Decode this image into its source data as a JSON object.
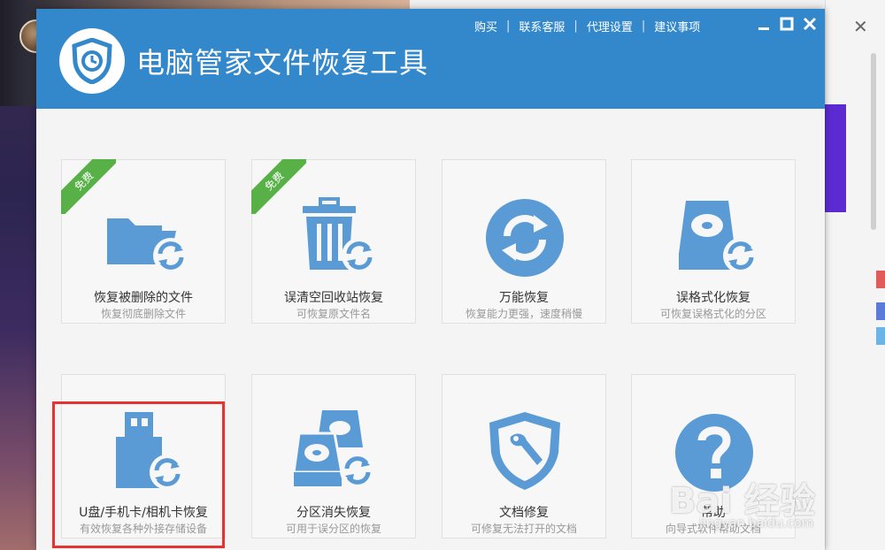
{
  "app": {
    "title": "电脑管家文件恢复工具",
    "menu": [
      "购买",
      "联系客服",
      "代理设置",
      "建议事项"
    ],
    "accent": "#3388cc",
    "icon_color": "#5b9bd5"
  },
  "free_badge": "免费",
  "cards": [
    {
      "name": "恢复被删除的文件",
      "desc": "恢复彻底删除文件",
      "icon": "folder-restore-icon",
      "free": true
    },
    {
      "name": "误清空回收站恢复",
      "desc": "可恢复原文件名",
      "icon": "trash-restore-icon",
      "free": true
    },
    {
      "name": "万能恢复",
      "desc": "恢复能力更强，速度稍慢",
      "icon": "universal-restore-icon",
      "free": false
    },
    {
      "name": "误格式化恢复",
      "desc": "可恢复误格式化的分区",
      "icon": "disk-format-restore-icon",
      "free": false
    },
    {
      "name": "U盘/手机卡/相机卡恢复",
      "desc": "有效恢复各种外接存储设备",
      "icon": "usb-restore-icon",
      "free": false
    },
    {
      "name": "分区消失恢复",
      "desc": "可用于误分区的恢复",
      "icon": "partition-restore-icon",
      "free": false
    },
    {
      "name": "文档修复",
      "desc": "可修复无法打开的文档",
      "icon": "document-repair-icon",
      "free": false
    },
    {
      "name": "帮助",
      "desc": "向导式软件帮助文档",
      "icon": "help-icon",
      "free": false
    }
  ],
  "watermark": {
    "brand": "Bai 经验",
    "url": "jingyan.baidu.com"
  }
}
